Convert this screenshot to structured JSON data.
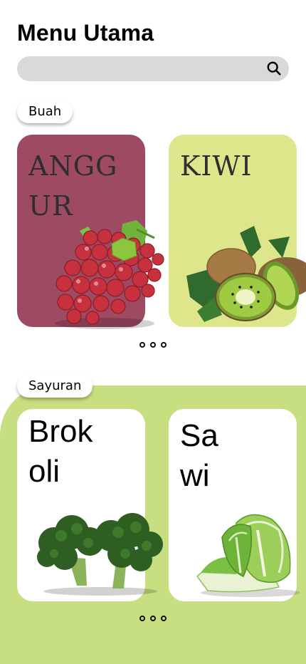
{
  "header": {
    "title": "Menu Utama"
  },
  "search": {
    "placeholder": "",
    "icon": "search-icon"
  },
  "sections": [
    {
      "label": "Buah",
      "cards": [
        {
          "name": "ANGGUR",
          "image": "grapes",
          "color": "#9e4a63"
        },
        {
          "name": "KIWI",
          "image": "kiwi",
          "color": "#dde68a"
        }
      ]
    },
    {
      "label": "Sayuran",
      "panel_color": "#c7df80",
      "cards": [
        {
          "name": "Brokoli",
          "image": "broccoli",
          "color": "#ffffff"
        },
        {
          "name": "Sawi",
          "image": "napa-cabbage",
          "color": "#ffffff"
        }
      ]
    }
  ]
}
